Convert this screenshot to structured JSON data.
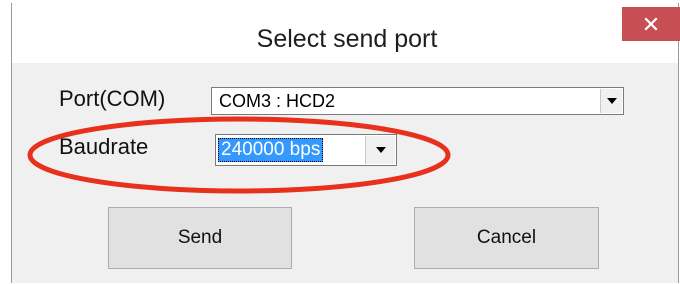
{
  "dialog": {
    "title": "Select send port",
    "close_symbol": "×"
  },
  "port": {
    "label": "Port(COM)",
    "value": "COM3 : HCD2"
  },
  "baudrate": {
    "label": "Baudrate",
    "value": "240000 bps"
  },
  "buttons": {
    "send": "Send",
    "cancel": "Cancel"
  },
  "icons": {
    "close": "close-icon",
    "dropdown": "chevron-down-icon"
  },
  "colors": {
    "close_button": "#c74f53",
    "selection": "#3399ff",
    "annotation": "#e8311d"
  }
}
